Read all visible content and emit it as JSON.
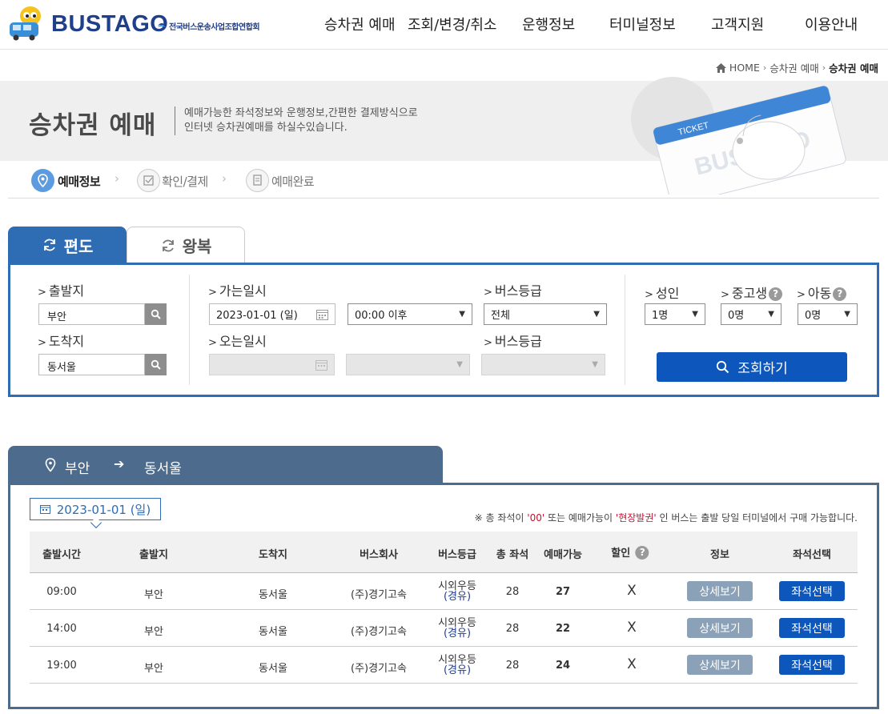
{
  "header": {
    "brand": "BUSTAGO",
    "association": "전국버스운송사업조합연합회",
    "nav": [
      "승차권 예매",
      "조회/변경/취소",
      "운행정보",
      "터미널정보",
      "고객지원",
      "이용안내"
    ]
  },
  "breadcrumb": {
    "home": "HOME",
    "section": "승차권 예매",
    "current": "승차권 예매"
  },
  "page": {
    "title": "승차권 예매",
    "desc_line1": "예매가능한 좌석정보와 운행정보,간편한 결제방식으로",
    "desc_line2": "인터넷 승차권예매를 하실수있습니다.",
    "banner_ticket": "TICKET",
    "banner_brand": "BUSTAGO"
  },
  "steps": [
    "예매정보",
    "확인/결제",
    "예매완료"
  ],
  "tabs": {
    "oneway": "편도",
    "round": "왕복"
  },
  "search": {
    "departure_label": "출발지",
    "departure_value": "부안",
    "arrival_label": "도착지",
    "arrival_value": "동서울",
    "go_date_label": "가는일시",
    "go_date_value": "2023-01-01 (일)",
    "go_time_value": "00:00 이후",
    "grade_label": "버스등급",
    "grade_value": "전체",
    "return_date_label": "오는일시",
    "return_grade_label": "버스등급",
    "adult_label": "성인",
    "adult_value": "1명",
    "student_label": "중고생",
    "student_value": "0명",
    "child_label": "아동",
    "child_value": "0명",
    "submit": "조회하기"
  },
  "route": {
    "from": "부안",
    "to": "동서울"
  },
  "results": {
    "date": "2023-01-01 (일)",
    "notice_a": "※ 총 좌석이 ",
    "notice_b": "'00'",
    "notice_c": " 또는 예매가능이 ",
    "notice_d": "'현장발권'",
    "notice_e": " 인 버스는 출발 당일 터미널에서 구매 가능합니다.",
    "columns": [
      "출발시간",
      "출발지",
      "도착지",
      "버스회사",
      "버스등급",
      "총 좌석",
      "예매가능",
      "할인",
      "정보",
      "좌석선택"
    ],
    "rows": [
      {
        "time": "09:00",
        "from": "부안",
        "to": "동서울",
        "company": "(주)경기고속",
        "grade": "시외우등",
        "via": "(경유)",
        "total": "28",
        "avail": "27",
        "discount": "X",
        "detail": "상세보기",
        "select": "좌석선택"
      },
      {
        "time": "14:00",
        "from": "부안",
        "to": "동서울",
        "company": "(주)경기고속",
        "grade": "시외우등",
        "via": "(경유)",
        "total": "28",
        "avail": "22",
        "discount": "X",
        "detail": "상세보기",
        "select": "좌석선택"
      },
      {
        "time": "19:00",
        "from": "부안",
        "to": "동서울",
        "company": "(주)경기고속",
        "grade": "시외우등",
        "via": "(경유)",
        "total": "28",
        "avail": "24",
        "discount": "X",
        "detail": "상세보기",
        "select": "좌석선택"
      }
    ]
  },
  "colors": {
    "primary": "#2e6cb4",
    "button": "#0d56bc",
    "route_header": "#4d6b8d",
    "notice_red": "#c8102e"
  }
}
